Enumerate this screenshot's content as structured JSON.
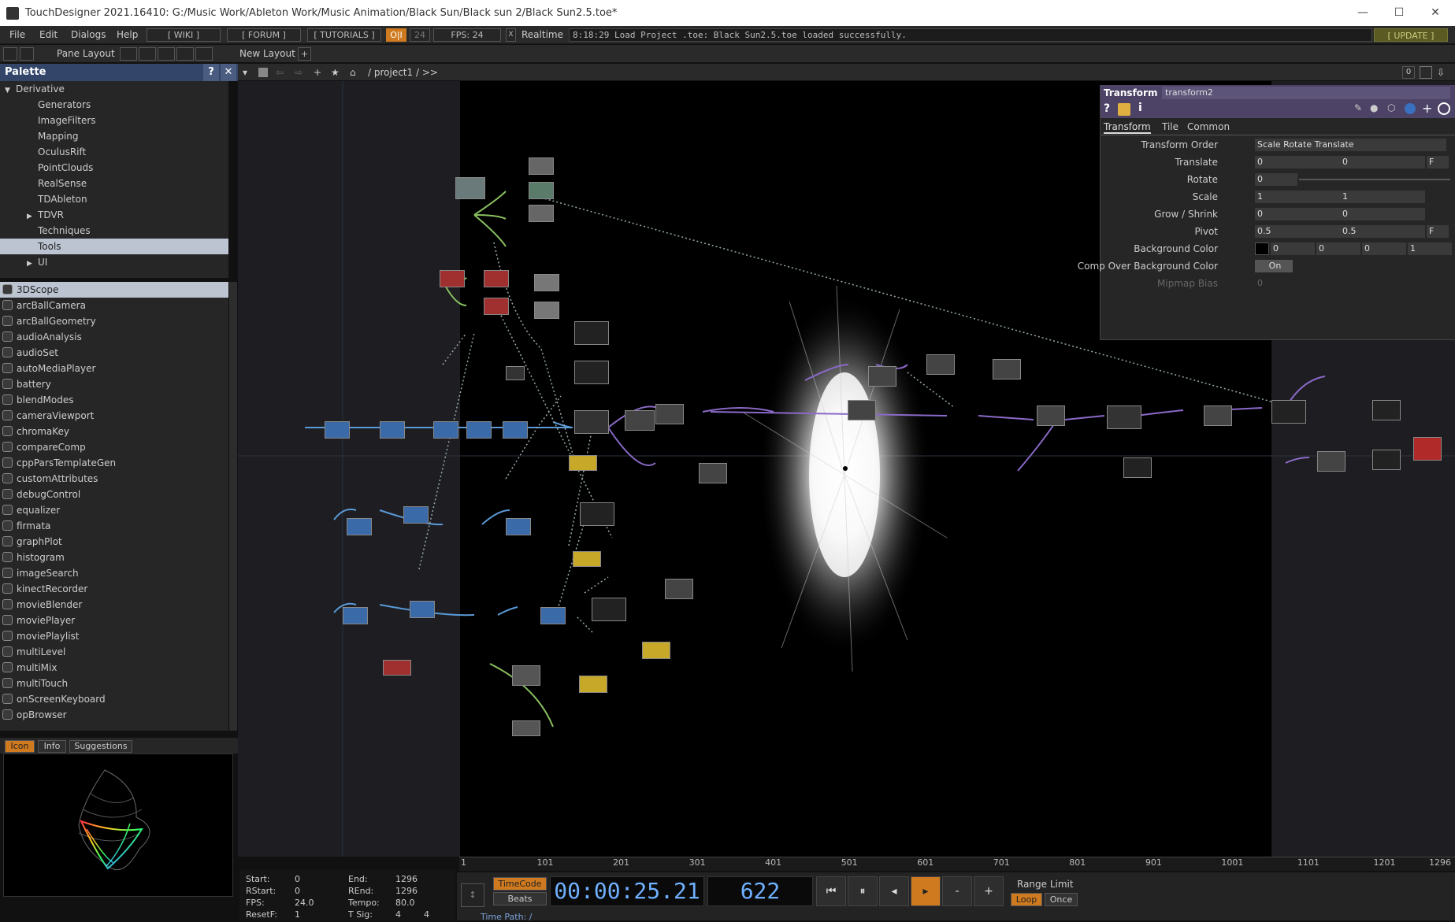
{
  "window": {
    "title": "TouchDesigner 2021.16410: G:/Music Work/Ableton Work/Music Animation/Black Sun/Black sun 2/Black Sun2.5.toe*",
    "minimize": "—",
    "maximize": "☐",
    "close": "✕"
  },
  "menu": {
    "items": [
      "File",
      "Edit",
      "Dialogs",
      "Help"
    ],
    "wiki": "[ WIKI ]",
    "forum": "[ FORUM ]",
    "tutorials": "[ TUTORIALS ]",
    "oi": "O|I",
    "fps_num": "24",
    "fps_label": "FPS:  24",
    "realtime_check": "X",
    "realtime": "Realtime",
    "log": "8:18:29 Load Project .toe: Black Sun2.5.toe loaded successfully.",
    "update": "[ UPDATE ]"
  },
  "toolbar": {
    "pane_layout": "Pane Layout",
    "new_layout": "New Layout",
    "add": "+"
  },
  "palette": {
    "title": "Palette",
    "help": "?",
    "close": "✕",
    "tree": [
      {
        "label": "Derivative",
        "indent": 0,
        "arrow": "▼",
        "selected": false
      },
      {
        "label": "Generators",
        "indent": 2,
        "arrow": "",
        "selected": false
      },
      {
        "label": "ImageFilters",
        "indent": 2,
        "arrow": "",
        "selected": false
      },
      {
        "label": "Mapping",
        "indent": 2,
        "arrow": "",
        "selected": false
      },
      {
        "label": "OculusRift",
        "indent": 2,
        "arrow": "",
        "selected": false
      },
      {
        "label": "PointClouds",
        "indent": 2,
        "arrow": "",
        "selected": false
      },
      {
        "label": "RealSense",
        "indent": 2,
        "arrow": "",
        "selected": false
      },
      {
        "label": "TDAbleton",
        "indent": 2,
        "arrow": "",
        "selected": false
      },
      {
        "label": "TDVR",
        "indent": 2,
        "arrow": "▶",
        "selected": false
      },
      {
        "label": "Techniques",
        "indent": 2,
        "arrow": "",
        "selected": false
      },
      {
        "label": "Tools",
        "indent": 2,
        "arrow": "",
        "selected": true
      },
      {
        "label": "UI",
        "indent": 2,
        "arrow": "▶",
        "selected": false
      }
    ],
    "items": [
      "3DScope",
      "arcBallCamera",
      "arcBallGeometry",
      "audioAnalysis",
      "audioSet",
      "autoMediaPlayer",
      "battery",
      "blendModes",
      "cameraViewport",
      "chromaKey",
      "compareComp",
      "cppParsTemplateGen",
      "customAttributes",
      "debugControl",
      "equalizer",
      "firmata",
      "graphPlot",
      "histogram",
      "imageSearch",
      "kinectRecorder",
      "movieBlender",
      "moviePlayer",
      "moviePlaylist",
      "multiLevel",
      "multiMix",
      "multiTouch",
      "onScreenKeyboard",
      "opBrowser"
    ],
    "selected_item": "3DScope",
    "tabs": [
      "Icon",
      "Info",
      "Suggestions"
    ],
    "active_tab": "Icon"
  },
  "network": {
    "path": "/ project1 / >>",
    "right_count": "0"
  },
  "params": {
    "op_type": "Transform",
    "op_name": "transform2",
    "tabs": [
      "Transform",
      "Tile",
      "Common"
    ],
    "active_tab": "Transform",
    "rows": [
      {
        "label": "Transform Order",
        "values": [
          "Scale Rotate Translate"
        ]
      },
      {
        "label": "Translate",
        "values": [
          "0",
          "0"
        ]
      },
      {
        "label": "Rotate",
        "values": [
          "0"
        ]
      },
      {
        "label": "Scale",
        "values": [
          "1",
          "1"
        ]
      },
      {
        "label": "Grow / Shrink",
        "values": [
          "0",
          "0"
        ]
      },
      {
        "label": "Pivot",
        "values": [
          "0.5",
          "0.5"
        ]
      },
      {
        "label": "Background Color",
        "values": [
          "0",
          "0",
          "0",
          "1"
        ]
      },
      {
        "label": "Comp Over Background Color",
        "values": [
          "On"
        ]
      },
      {
        "label": "Mipmap Bias",
        "values": [
          "0"
        ]
      }
    ],
    "unit_btn": "F"
  },
  "timeline": {
    "ticks": [
      "1",
      "101",
      "201",
      "301",
      "401",
      "501",
      "601",
      "701",
      "801",
      "901",
      "1001",
      "1101",
      "1201",
      "1296"
    ],
    "start_label": "Start:",
    "start": "0",
    "end_label": "End:",
    "end": "1296",
    "rstart_label": "RStart:",
    "rstart": "0",
    "rend_label": "REnd:",
    "rend": "1296",
    "fps_label": "FPS:",
    "fps": "24.0",
    "tempo_label": "Tempo:",
    "tempo": "80.0",
    "resetf_label": "ResetF:",
    "resetf": "1",
    "tsig_label": "T Sig:",
    "tsig1": "4",
    "tsig2": "4",
    "timecode_btn": "TimeCode",
    "beats_btn": "Beats",
    "timecode": "00:00:25.21",
    "frame": "622",
    "range_limit": "Range Limit",
    "loop": "Loop",
    "once": "Once",
    "time_path": "Time Path: /"
  },
  "colors": {
    "accent": "#33466a",
    "params_header": "#4c4366",
    "highlight": "#f0a030"
  }
}
